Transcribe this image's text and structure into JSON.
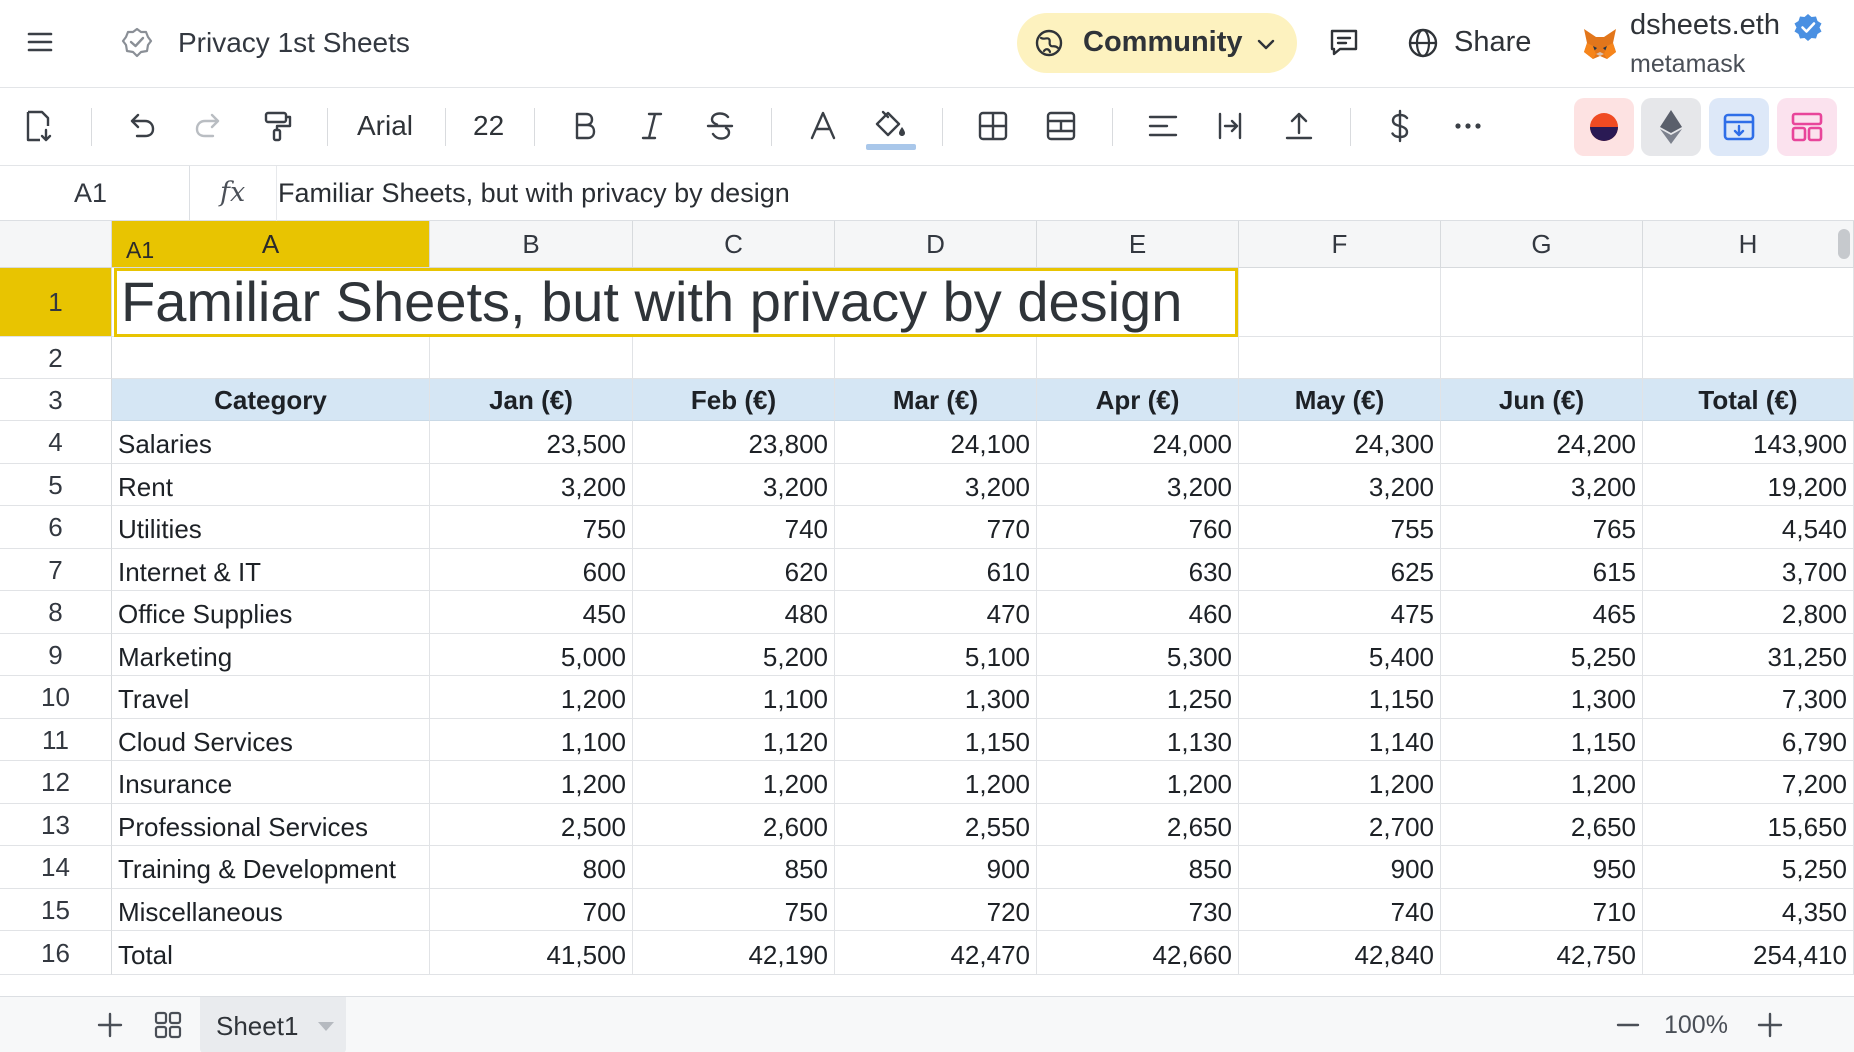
{
  "header": {
    "doc_title": "Privacy 1st Sheets",
    "community_label": "Community",
    "share_label": "Share",
    "user_name": "dsheets.eth",
    "user_sub": "metamask"
  },
  "toolbar": {
    "font_name": "Arial",
    "font_size": "22"
  },
  "formula_bar": {
    "cell_ref": "A1",
    "fx_label": "fx",
    "value": "Familiar Sheets, but with privacy by design"
  },
  "grid": {
    "selected_tag": "A1",
    "columns": [
      "A",
      "B",
      "C",
      "D",
      "E",
      "F",
      "G",
      "H"
    ],
    "row_numbers": [
      "1",
      "2",
      "3",
      "4",
      "5",
      "6",
      "7",
      "8",
      "9",
      "10",
      "11",
      "12",
      "13",
      "14",
      "15",
      "16"
    ],
    "title": "Familiar Sheets, but with privacy by design",
    "table_headers": [
      "Category",
      "Jan (€)",
      "Feb (€)",
      "Mar (€)",
      "Apr (€)",
      "May (€)",
      "Jun (€)",
      "Total (€)"
    ],
    "rows": [
      [
        "Salaries",
        "23,500",
        "23,800",
        "24,100",
        "24,000",
        "24,300",
        "24,200",
        "143,900"
      ],
      [
        "Rent",
        "3,200",
        "3,200",
        "3,200",
        "3,200",
        "3,200",
        "3,200",
        "19,200"
      ],
      [
        "Utilities",
        "750",
        "740",
        "770",
        "760",
        "755",
        "765",
        "4,540"
      ],
      [
        "Internet & IT",
        "600",
        "620",
        "610",
        "630",
        "625",
        "615",
        "3,700"
      ],
      [
        "Office Supplies",
        "450",
        "480",
        "470",
        "460",
        "475",
        "465",
        "2,800"
      ],
      [
        "Marketing",
        "5,000",
        "5,200",
        "5,100",
        "5,300",
        "5,400",
        "5,250",
        "31,250"
      ],
      [
        "Travel",
        "1,200",
        "1,100",
        "1,300",
        "1,250",
        "1,150",
        "1,300",
        "7,300"
      ],
      [
        "Cloud Services",
        "1,100",
        "1,120",
        "1,150",
        "1,130",
        "1,140",
        "1,150",
        "6,790"
      ],
      [
        "Insurance",
        "1,200",
        "1,200",
        "1,200",
        "1,200",
        "1,200",
        "1,200",
        "7,200"
      ],
      [
        "Professional Services",
        "2,500",
        "2,600",
        "2,550",
        "2,650",
        "2,700",
        "2,650",
        "15,650"
      ],
      [
        "Training & Development",
        "800",
        "850",
        "900",
        "850",
        "900",
        "950",
        "5,250"
      ],
      [
        "Miscellaneous",
        "700",
        "750",
        "720",
        "730",
        "740",
        "710",
        "4,350"
      ],
      [
        "Total",
        "41,500",
        "42,190",
        "42,470",
        "42,660",
        "42,840",
        "42,750",
        "254,410"
      ]
    ]
  },
  "bottom": {
    "sheet_name": "Sheet1",
    "zoom": "100%"
  },
  "colors": {
    "accent_yellow": "#e8c401",
    "community_bg": "#fdf2bf",
    "table_header_bg": "#d5e6f4",
    "verified_blue": "#4a90e2"
  },
  "icons": [
    "menu-icon",
    "doc-status-icon",
    "community-icon",
    "chevron-down-icon",
    "comment-icon",
    "globe-icon",
    "fox-icon",
    "verified-icon",
    "save-icon",
    "undo-icon",
    "redo-icon",
    "paint-format-icon",
    "bold-icon",
    "italic-icon",
    "strikethrough-icon",
    "text-color-icon",
    "fill-color-icon",
    "borders-icon",
    "merge-icon",
    "align-icon",
    "wrap-icon",
    "vertical-align-icon",
    "currency-icon",
    "more-icon",
    "add-sheet-icon",
    "sheets-grid-icon",
    "zoom-out-icon",
    "zoom-in-icon"
  ]
}
